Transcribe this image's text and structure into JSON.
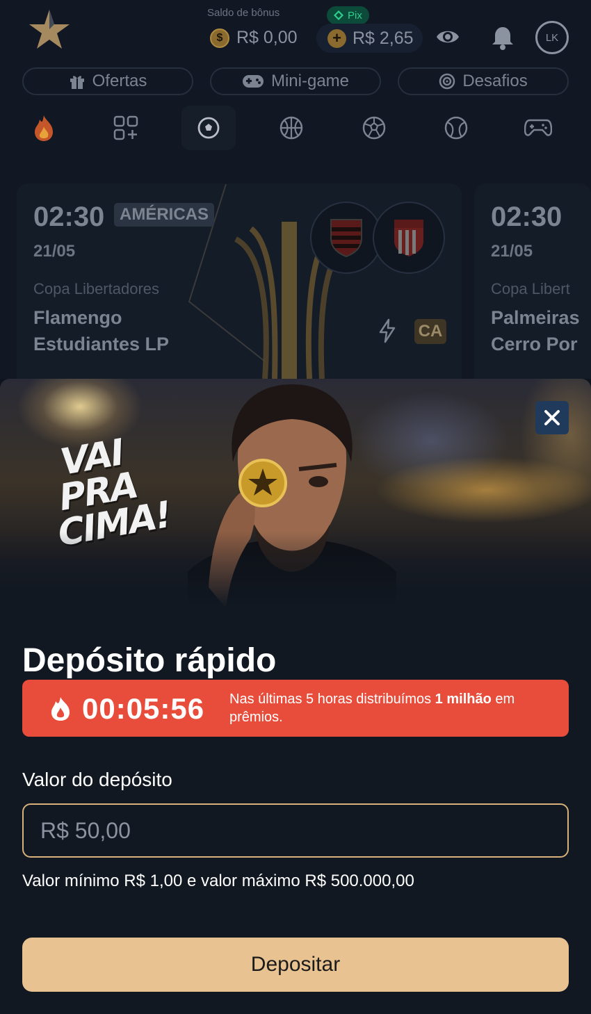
{
  "header": {
    "bonus_label": "Saldo de bônus",
    "bonus_value": "R$ 0,00",
    "bonus_icon_symbol": "$",
    "pix_label": "Pix",
    "balance_value": "R$ 2,65",
    "balance_plus": "+",
    "avatar_initials": "LK"
  },
  "pills": [
    {
      "label": "Ofertas",
      "icon": "gift-icon"
    },
    {
      "label": "Mini-game",
      "icon": "gamepad-icon"
    },
    {
      "label": "Desafios",
      "icon": "target-icon"
    }
  ],
  "categories": [
    {
      "icon": "fire-icon",
      "active": false
    },
    {
      "icon": "grid-plus-icon",
      "active": false
    },
    {
      "icon": "soccer-ball-icon",
      "active": true
    },
    {
      "icon": "basketball-icon",
      "active": false
    },
    {
      "icon": "esports-ball-icon",
      "active": false
    },
    {
      "icon": "tennis-ball-icon",
      "active": false
    },
    {
      "icon": "gamepad-icon",
      "active": false
    }
  ],
  "matches": [
    {
      "time": "02:30",
      "tag": "AMÉRICAS",
      "date": "21/05",
      "league": "Copa Libertadores",
      "home": "Flamengo",
      "away": "Estudiantes LP",
      "badge": "CA"
    },
    {
      "time": "02:30",
      "date": "21/05",
      "league": "Copa Libert",
      "home": "Palmeiras",
      "away": "Cerro Por"
    }
  ],
  "modal": {
    "banner_slogan_line1": "VAI PRA",
    "banner_slogan_line2": "CIMA!",
    "title": "Depósito rápido",
    "timer": "00:05:56",
    "promo_text_before": "Nas últimas 5 horas distribuímos ",
    "promo_text_bold": "1 milhão",
    "promo_text_after": " em prêmios.",
    "field_label": "Valor do depósito",
    "amount_placeholder": "R$ 50,00",
    "limits_text": "Valor mínimo R$ 1,00 e valor máximo R$ 500.000,00",
    "submit_label": "Depositar"
  },
  "colors": {
    "background": "#0e141d",
    "promo_red": "#e84d3c",
    "accent_gold": "#e8c290",
    "pix_green": "#2fcf8e",
    "close_blue": "#1f3a5a"
  }
}
